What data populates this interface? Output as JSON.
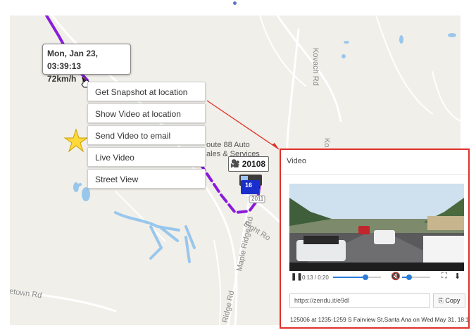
{
  "tooltip": {
    "date": "Mon, Jan 23, 03:39:13",
    "speed": "72km/h"
  },
  "context_menu": {
    "items": [
      "Get Snapshot at location",
      "Show Video at location",
      "Send Video to email",
      "Live Video",
      "Street View"
    ]
  },
  "vehicle": {
    "id": "20108",
    "badge": "16"
  },
  "map_labels": {
    "kovach": "Kovach Rd",
    "maple": "Maple Ridge Rd",
    "eight": "Eight Ro",
    "ridge": "Ridge Rd",
    "etown": "etown Rd",
    "ko": "Ko",
    "shield": "2011",
    "business_line1": "oute 88 Auto",
    "business_line2": "ales & Services"
  },
  "video_panel": {
    "title": "Video",
    "time": "0:13 / 0:20",
    "url": "https://zendu.it/e9dl",
    "copy_label": "Copy",
    "caption": "125006 at 1235-1259 S Fairview St,Santa Ana on Wed May 31, 18:1"
  },
  "colors": {
    "route": "#8a1bdc",
    "highlight": "#e0302b",
    "vehicle": "#1a2ecc",
    "star": "#ffd83a"
  },
  "icons": [
    "hand-cursor-icon",
    "star-icon",
    "vehicle-icon",
    "camera-icon",
    "pause-icon",
    "mute-icon",
    "fullscreen-icon",
    "download-icon",
    "copy-icon"
  ]
}
